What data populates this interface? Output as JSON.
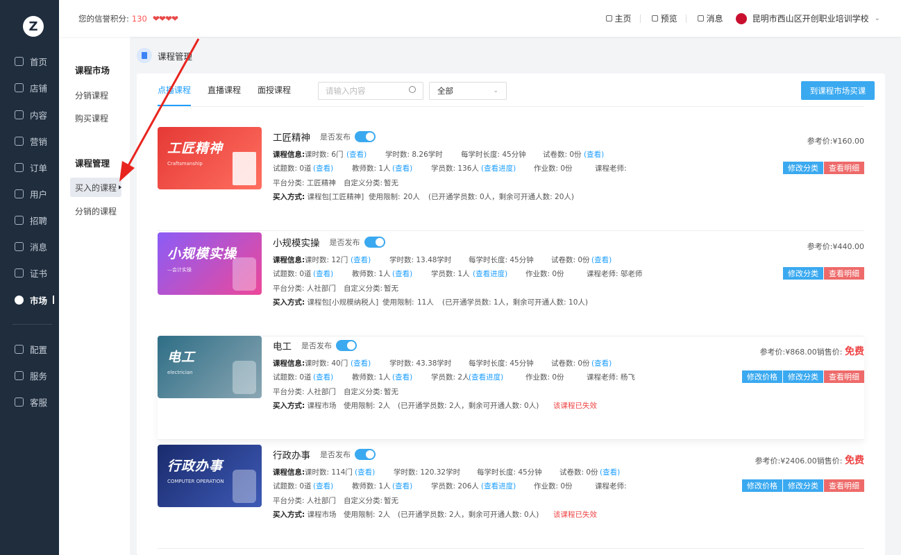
{
  "nav": {
    "logo": "Z",
    "items": [
      {
        "label": "首页",
        "icon": "home-icon"
      },
      {
        "label": "店铺",
        "icon": "store-icon"
      },
      {
        "label": "内容",
        "icon": "content-icon"
      },
      {
        "label": "营销",
        "icon": "marketing-icon"
      },
      {
        "label": "订单",
        "icon": "order-icon"
      },
      {
        "label": "用户",
        "icon": "user-icon"
      },
      {
        "label": "招聘",
        "icon": "recruit-icon"
      },
      {
        "label": "消息",
        "icon": "message-icon"
      },
      {
        "label": "证书",
        "icon": "certificate-icon"
      },
      {
        "label": "市场",
        "icon": "market-icon"
      },
      {
        "label": "配置",
        "icon": "config-icon"
      },
      {
        "label": "服务",
        "icon": "service-icon"
      },
      {
        "label": "客服",
        "icon": "support-icon"
      }
    ]
  },
  "subnav": {
    "group1": "课程市场",
    "g1_items": [
      "分销课程",
      "购买课程"
    ],
    "group2": "课程管理",
    "g2_items": [
      "买入的课程",
      "分销的课程"
    ]
  },
  "header": {
    "credit_label": "您的信誉积分:",
    "credit_score": "130",
    "hearts": "❤❤❤❤",
    "links": [
      "主页",
      "预览",
      "消息"
    ],
    "school": "昆明市西山区开创职业培训学校"
  },
  "breadcrumb": "课程管理",
  "toolbar": {
    "tabs": [
      "点播课程",
      "直播课程",
      "面授课程"
    ],
    "search_placeholder": "请输入内容",
    "select_value": "全部",
    "buy_button": "到课程市场买课"
  },
  "labels": {
    "publish": "是否发布",
    "course_info": "课程信息:",
    "platform": "平台分类:",
    "custom": "自定义分类:",
    "buy_method": "买入方式:",
    "limit": "使用限制:",
    "ref_price": "参考价:",
    "sale_price": "销售价:",
    "view": "(查看)",
    "view_progress": "(查看进度)",
    "edit_price": "修改价格",
    "edit_category": "修改分类",
    "view_detail": "查看明细"
  },
  "courses": [
    {
      "name": "工匠精神",
      "thumb_title": "工匠精神",
      "thumb_sub": "Craftsmanship",
      "hours": "课时数: 6门",
      "study": "学时数: 8.26学时",
      "per": "每学时长度: 45分钟",
      "papers": "试卷数: 0份",
      "questions": "试题数: 0道",
      "teachers": "教师数: 1人",
      "students": "学员数: 136人",
      "homework": "作业数: 0份",
      "teacher": "课程老师:",
      "platform": "工匠精神",
      "custom": "暂无",
      "method": "课程包[工匠精神]",
      "limit": "20人",
      "opened": "(已开通学员数: 0人，剩余可开通人数: 20人)",
      "expired": "",
      "ref": "¥160.00",
      "sale": "",
      "free": ""
    },
    {
      "name": "小规模实操",
      "thumb_title": "小规模实操",
      "thumb_sub": "—会计实操",
      "hours": "课时数: 12门",
      "study": "学时数: 13.48学时",
      "per": "每学时长度: 45分钟",
      "papers": "试卷数: 0份",
      "questions": "试题数: 0道",
      "teachers": "教师数: 1人",
      "students": "学员数: 1人",
      "homework": "作业数: 0份",
      "teacher": "课程老师: 邬老师",
      "platform": "人社部门",
      "custom": "暂无",
      "method": "课程包[小规模纳税人]",
      "limit": "11人",
      "opened": "(已开通学员数: 1人，剩余可开通人数: 10人)",
      "expired": "",
      "ref": "¥440.00",
      "sale": "",
      "free": ""
    },
    {
      "name": "电工",
      "thumb_title": "电工",
      "thumb_sub": "electrician",
      "hours": "课时数: 40门",
      "study": "学时数: 43.38学时",
      "per": "每学时长度: 45分钟",
      "papers": "试卷数: 0份",
      "questions": "试题数: 0道",
      "teachers": "教师数: 1人",
      "students": "学员数: 2人",
      "homework": "作业数: 0份",
      "teacher": "课程老师: 杨飞",
      "platform": "人社部门",
      "custom": "暂无",
      "method": "课程市场",
      "limit": "2人",
      "opened": "(已开通学员数: 2人，剩余可开通人数: 0人)",
      "expired": "该课程已失效",
      "ref": "¥868.00",
      "sale": "销售价:",
      "free": "免费"
    },
    {
      "name": "行政办事",
      "thumb_title": "行政办事",
      "thumb_sub": "COMPUTER OPERATION",
      "hours": "课时数: 114门",
      "study": "学时数: 120.32学时",
      "per": "每学时长度: 45分钟",
      "papers": "试卷数: 0份",
      "questions": "试题数: 0道",
      "teachers": "教师数: 1人",
      "students": "学员数: 206人",
      "homework": "作业数: 0份",
      "teacher": "课程老师:",
      "platform": "人社部门",
      "custom": "暂无",
      "method": "课程市场",
      "limit": "2人",
      "opened": "(已开通学员数: 2人，剩余可开通人数: 0人)",
      "expired": "该课程已失效",
      "ref": "¥2406.00",
      "sale": "销售价:",
      "free": "免费"
    }
  ],
  "colors": {
    "accent": "#3aa9f0",
    "danger": "#ee6a6a",
    "nav_bg": "#1f2d3d",
    "annotation_arrow": "#e8241e"
  }
}
